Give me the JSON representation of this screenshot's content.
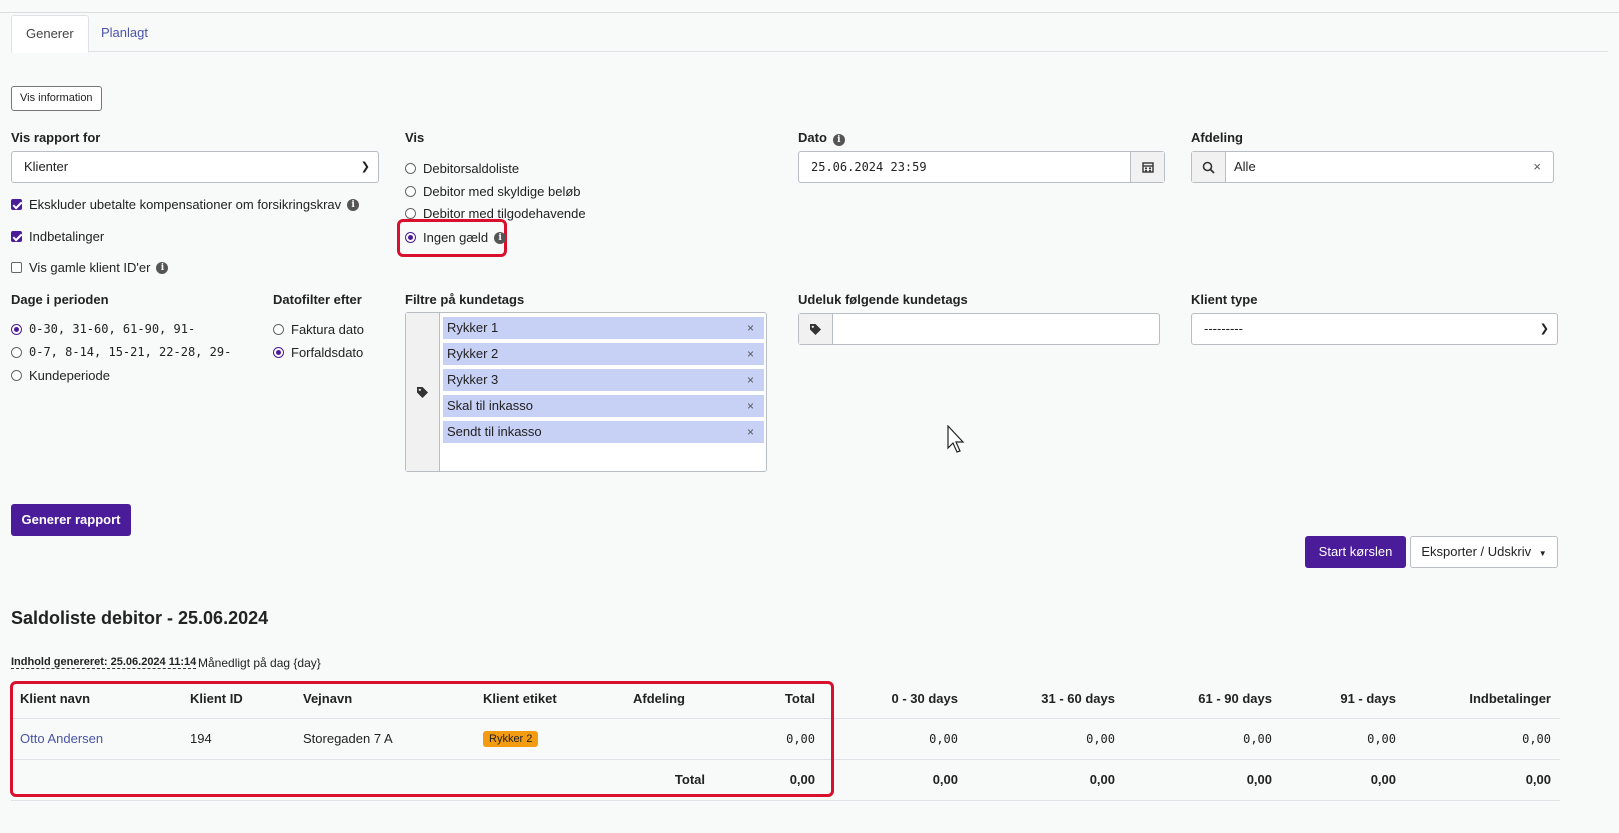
{
  "tabs": [
    {
      "label": "Generer"
    },
    {
      "label": "Planlagt"
    }
  ],
  "info_button": "Vis information",
  "report_for": {
    "label": "Vis rapport for",
    "value": "Klienter"
  },
  "checkboxes": [
    {
      "label": "Ekskluder ubetalte kompensationer om forsikringskrav",
      "checked": true
    },
    {
      "label": "Indbetalinger",
      "checked": true
    },
    {
      "label": "Vis gamle klient ID'er",
      "checked": false
    }
  ],
  "vis": {
    "label": "Vis",
    "options": [
      {
        "label": "Debitorsaldoliste",
        "selected": false
      },
      {
        "label": "Debitor med skyldige beløb",
        "selected": false
      },
      {
        "label": "Debitor med tilgodehavende",
        "selected": false
      },
      {
        "label": "Ingen gæld",
        "selected": true
      }
    ]
  },
  "dato": {
    "label": "Dato",
    "value": "25.06.2024 23:59"
  },
  "afdeling": {
    "label": "Afdeling",
    "value": "Alle",
    "clear": "×"
  },
  "periode": {
    "label": "Dage i perioden",
    "options": [
      {
        "label": "0-30, 31-60, 61-90, 91-",
        "selected": true
      },
      {
        "label": "0-7, 8-14, 15-21, 22-28, 29-",
        "selected": false
      },
      {
        "label": "Kundeperiode",
        "selected": false
      }
    ]
  },
  "datofilter": {
    "label": "Datofilter efter",
    "options": [
      {
        "label": "Faktura dato",
        "selected": false
      },
      {
        "label": "Forfaldsdato",
        "selected": true
      }
    ]
  },
  "filter_tags": {
    "label": "Filtre på kundetags",
    "tags": [
      "Rykker 1",
      "Rykker 2",
      "Rykker 3",
      "Skal til inkasso",
      "Sendt til inkasso"
    ],
    "remove": "×"
  },
  "exclude_tags": {
    "label": "Udeluk følgende kundetags",
    "value": ""
  },
  "client_type": {
    "label": "Klient type",
    "value": "---------"
  },
  "buttons": {
    "generate": "Generer rapport",
    "start": "Start kørslen",
    "export": "Eksporter / Udskriv"
  },
  "report": {
    "title": "Saldoliste debitor - 25.06.2024",
    "generated": "Indhold genereret: 25.06.2024 11:14",
    "schedule": "Månedligt på dag {day}"
  },
  "table": {
    "headers": [
      "Klient navn",
      "Klient ID",
      "Vejnavn",
      "Klient etiket",
      "Afdeling",
      "Total",
      "0 - 30 days",
      "31 - 60 days",
      "61 - 90 days",
      "91 - days",
      "Indbetalinger"
    ],
    "rows": [
      {
        "name": "Otto Andersen",
        "id": "194",
        "street": "Storegaden 7 A",
        "tag": "Rykker 2",
        "afdeling": "",
        "total": "0,00",
        "d0_30": "0,00",
        "d31_60": "0,00",
        "d61_90": "0,00",
        "d91": "0,00",
        "indbetalinger": "0,00"
      }
    ],
    "footer": {
      "label": "Total",
      "total": "0,00",
      "d0_30": "0,00",
      "d31_60": "0,00",
      "d61_90": "0,00",
      "d91": "0,00",
      "indbetalinger": "0,00"
    }
  },
  "colors": {
    "primary": "#4b1c99",
    "highlight": "#d8102e",
    "chip": "#c7d0f5",
    "badge": "#f39c12"
  }
}
